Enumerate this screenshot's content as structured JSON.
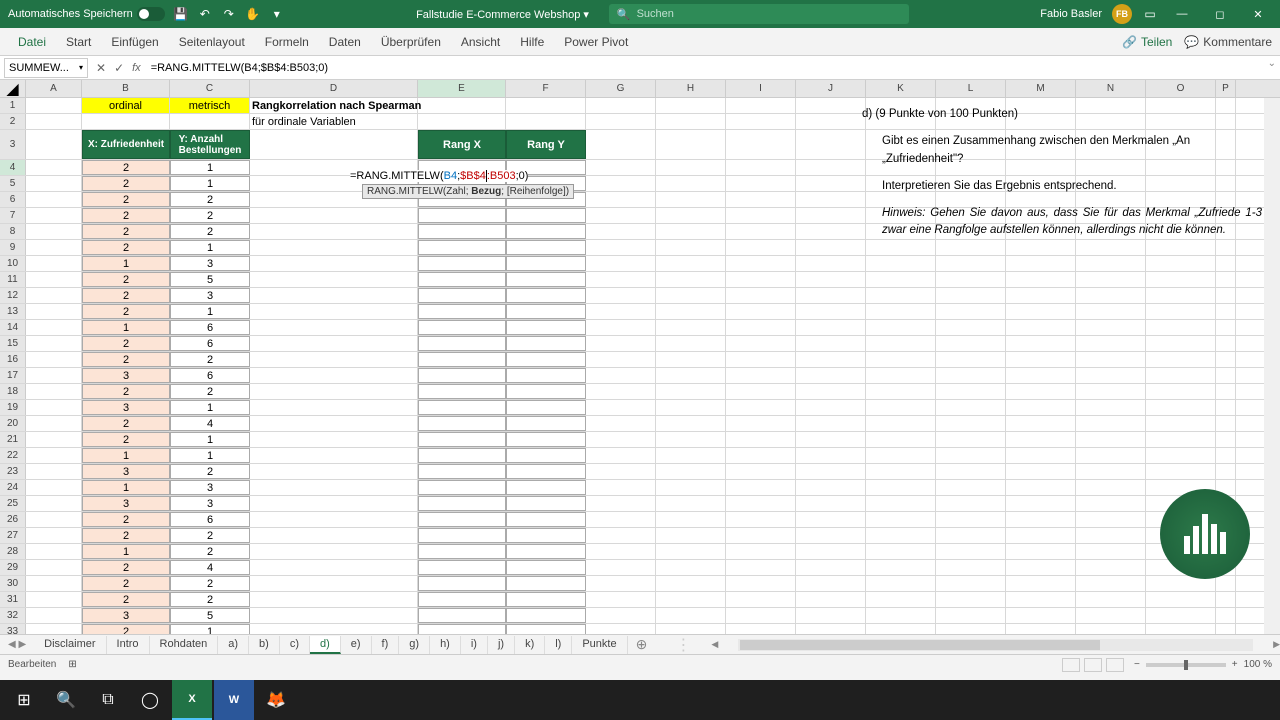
{
  "titlebar": {
    "autosave": "Automatisches Speichern",
    "doc_title": "Fallstudie E-Commerce Webshop ▾",
    "search_placeholder": "Suchen",
    "user_name": "Fabio Basler",
    "user_initials": "FB"
  },
  "ribbon": {
    "tabs": [
      "Datei",
      "Start",
      "Einfügen",
      "Seitenlayout",
      "Formeln",
      "Daten",
      "Überprüfen",
      "Ansicht",
      "Hilfe",
      "Power Pivot"
    ],
    "share": "Teilen",
    "comments": "Kommentare"
  },
  "formula_bar": {
    "name_box": "SUMMEW...",
    "formula": "=RANG.MITTELW(B4;$B$4:B503;0)"
  },
  "columns": [
    "A",
    "B",
    "C",
    "D",
    "E",
    "F",
    "G",
    "H",
    "I",
    "J",
    "K",
    "L",
    "M",
    "N",
    "O",
    "P"
  ],
  "headers": {
    "b1": "ordinal",
    "c1": "metrisch",
    "d1": "Rangkorrelation nach Spearman",
    "d2": "für ordinale Variablen",
    "b3": "X: Zufriedenheit",
    "c3": "Y: Anzahl Bestellungen",
    "e3": "Rang X",
    "f3": "Rang Y"
  },
  "formula_in_cell": "=RANG.MITTELW(B4;$B$4:B503;0)",
  "tooltip": "RANG.MITTELW(Zahl; Bezug; [Reihenfolge])",
  "rows": [
    {
      "n": 4,
      "b": 2,
      "c": 1
    },
    {
      "n": 5,
      "b": 2,
      "c": 1
    },
    {
      "n": 6,
      "b": 2,
      "c": 2
    },
    {
      "n": 7,
      "b": 2,
      "c": 2
    },
    {
      "n": 8,
      "b": 2,
      "c": 2
    },
    {
      "n": 9,
      "b": 2,
      "c": 1
    },
    {
      "n": 10,
      "b": 1,
      "c": 3
    },
    {
      "n": 11,
      "b": 2,
      "c": 5
    },
    {
      "n": 12,
      "b": 2,
      "c": 3
    },
    {
      "n": 13,
      "b": 2,
      "c": 1
    },
    {
      "n": 14,
      "b": 1,
      "c": 6
    },
    {
      "n": 15,
      "b": 2,
      "c": 6
    },
    {
      "n": 16,
      "b": 2,
      "c": 2
    },
    {
      "n": 17,
      "b": 3,
      "c": 6
    },
    {
      "n": 18,
      "b": 2,
      "c": 2
    },
    {
      "n": 19,
      "b": 3,
      "c": 1
    },
    {
      "n": 20,
      "b": 2,
      "c": 4
    },
    {
      "n": 21,
      "b": 2,
      "c": 1
    },
    {
      "n": 22,
      "b": 1,
      "c": 1
    },
    {
      "n": 23,
      "b": 3,
      "c": 2
    },
    {
      "n": 24,
      "b": 1,
      "c": 3
    },
    {
      "n": 25,
      "b": 3,
      "c": 3
    },
    {
      "n": 26,
      "b": 2,
      "c": 6
    },
    {
      "n": 27,
      "b": 2,
      "c": 2
    },
    {
      "n": 28,
      "b": 1,
      "c": 2
    },
    {
      "n": 29,
      "b": 2,
      "c": 4
    },
    {
      "n": 30,
      "b": 2,
      "c": 2
    },
    {
      "n": 31,
      "b": 2,
      "c": 2
    },
    {
      "n": 32,
      "b": 3,
      "c": 5
    },
    {
      "n": 33,
      "b": 2,
      "c": 1
    }
  ],
  "question": {
    "title": "d) (9 Punkte von 100 Punkten)",
    "q1a": "Gibt es einen Zusammenhang zwischen den Merkmalen „An",
    "q1b": "„Zufriedenheit\"?",
    "q2": "Interpretieren Sie das Ergebnis entsprechend.",
    "hint": "Hinweis: Gehen Sie davon aus, dass Sie für das Merkmal „Zufriede 1-3 zwar eine Rangfolge aufstellen können, allerdings nicht die können."
  },
  "sheets": [
    "Disclaimer",
    "Intro",
    "Rohdaten",
    "a)",
    "b)",
    "c)",
    "d)",
    "e)",
    "f)",
    "g)",
    "h)",
    "i)",
    "j)",
    "k)",
    "l)",
    "Punkte"
  ],
  "active_sheet": "d)",
  "status": {
    "mode": "Bearbeiten",
    "zoom": "100 %"
  }
}
